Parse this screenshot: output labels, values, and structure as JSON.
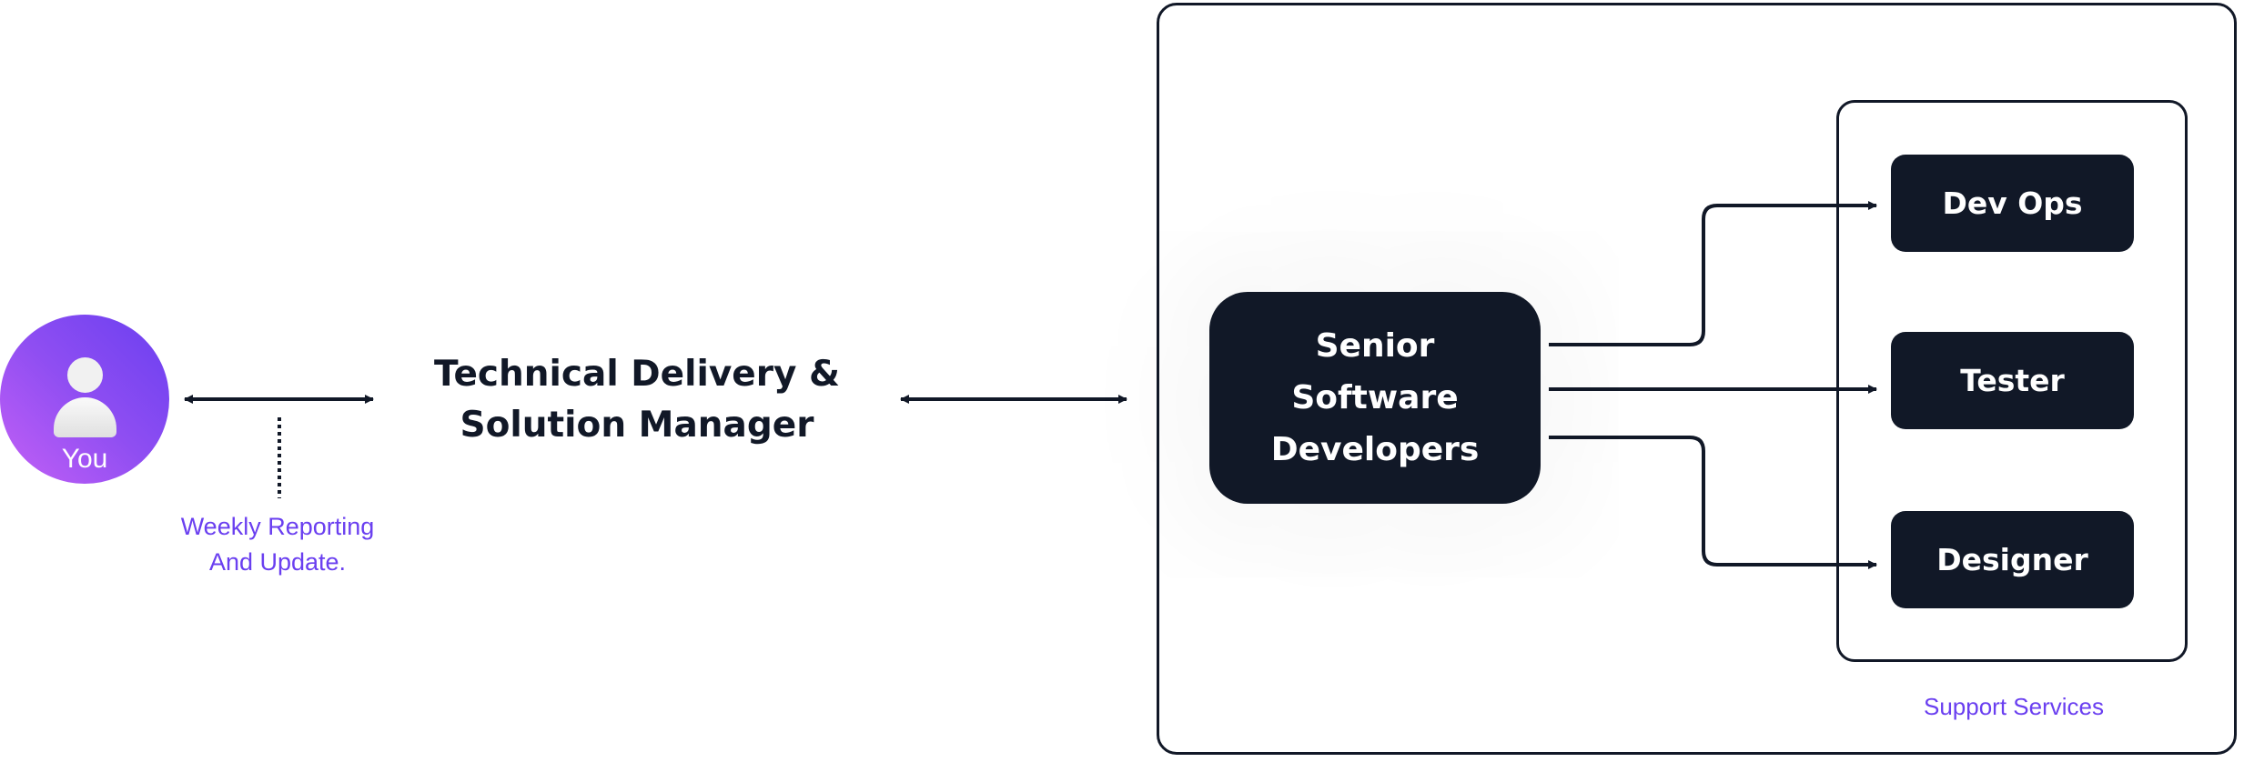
{
  "client": {
    "label": "You",
    "icon": "user-icon",
    "gradient": [
      "#c460f6",
      "#6a3ff0"
    ]
  },
  "reporting_note": {
    "line1": "Weekly Reporting",
    "line2": "And Update."
  },
  "manager": {
    "line1": "Technical Delivery &",
    "line2": "Solution Manager"
  },
  "team": {
    "line1": "Senior",
    "line2": "Software",
    "line3": "Developers"
  },
  "support_services": {
    "label": "Support Services",
    "items": [
      {
        "label": "Dev Ops"
      },
      {
        "label": "Tester"
      },
      {
        "label": "Designer"
      }
    ]
  },
  "colors": {
    "dark": "#111827",
    "accent": "#6a3ff0",
    "background": "#ffffff"
  }
}
